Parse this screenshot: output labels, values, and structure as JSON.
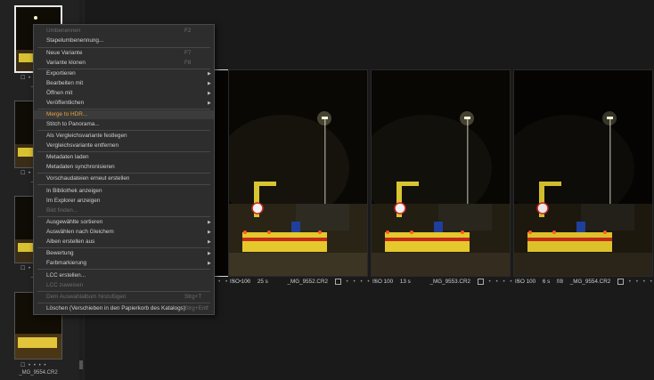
{
  "filmstrip": {
    "thumbnails": [
      {
        "label": "_MG_",
        "dots": "☐ • • • •"
      },
      {
        "label": "_MG_",
        "dots": "☐ • • • •"
      },
      {
        "label": "_MG_",
        "dots": "☐ • • • •"
      },
      {
        "label": "_MG_9554.CR2",
        "dots": "☐ • • • •"
      }
    ]
  },
  "photos": [
    {
      "iso": "",
      "shutter": "",
      "aperture": "",
      "filename": "",
      "dots": "• • • • •"
    },
    {
      "iso": "ISO 100",
      "shutter": "25 s",
      "aperture": "",
      "filename": "_MG_9552.CR2",
      "dots": "• • • • •"
    },
    {
      "iso": "ISO 100",
      "shutter": "13 s",
      "aperture": "",
      "filename": "_MG_9553.CR2",
      "dots": "• • • • •"
    },
    {
      "iso": "ISO 100",
      "shutter": "6 s",
      "aperture": "f/8",
      "filename": "_MG_9554.CR2",
      "dots": "• • • • •"
    }
  ],
  "menu": {
    "items": [
      {
        "label": "Umbenennen",
        "shortcut": "F2"
      },
      {
        "label": "Stapelumbenennung..."
      },
      {
        "label": "Neue Variante",
        "shortcut": "F7"
      },
      {
        "label": "Variante klonen",
        "shortcut": "F8"
      },
      {
        "label": "Exportieren"
      },
      {
        "label": "Bearbeiten mit"
      },
      {
        "label": "Öffnen mit"
      },
      {
        "label": "Veröffentlichen"
      },
      {
        "label": "Merge to HDR..."
      },
      {
        "label": "Stitch to Panorama..."
      },
      {
        "label": "Als Vergleichsvariante festlegen"
      },
      {
        "label": "Vergleichsvariante entfernen"
      },
      {
        "label": "Metadaten laden"
      },
      {
        "label": "Metadaten synchronisieren"
      },
      {
        "label": "Vorschaudateien erneut erstellen"
      },
      {
        "label": "In Bibliothek anzeigen"
      },
      {
        "label": "Im Explorer anzeigen"
      },
      {
        "label": "Bild finden..."
      },
      {
        "label": "Ausgewählte sortieren"
      },
      {
        "label": "Auswählen nach Gleichem"
      },
      {
        "label": "Alben erstellen aus"
      },
      {
        "label": "Bewertung"
      },
      {
        "label": "Farbmarkierung"
      },
      {
        "label": "LCC erstellen..."
      },
      {
        "label": "LCC zuweisen"
      },
      {
        "label": "Dem Auswahlalbum hinzufügen",
        "shortcut": "Strg+T"
      },
      {
        "label": "Löschen (Verschieben in den Papierkorb des Katalogs)",
        "shortcut": "Strg+Entf"
      }
    ]
  },
  "colors": {
    "highlight_text": "#e8a23c",
    "menu_bg": "#2d2d2d",
    "disabled_text": "#6c6c6c"
  }
}
